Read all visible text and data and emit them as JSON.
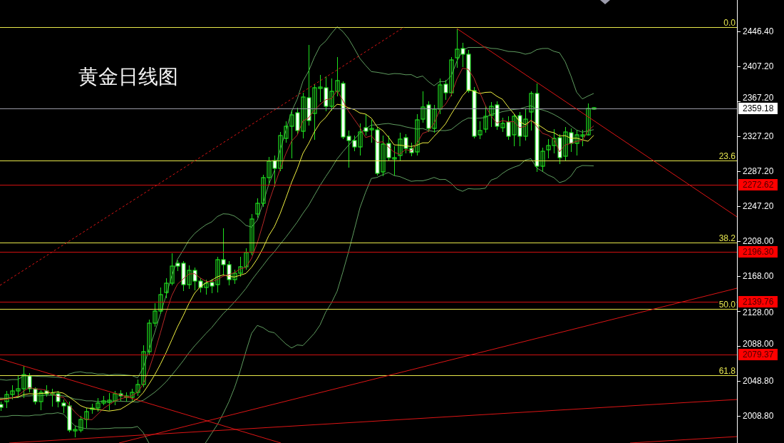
{
  "chart": {
    "title": "黄金日线图",
    "price_axis": [
      "2446.40",
      "2407.20",
      "2367.20",
      "2327.20",
      "2287.20",
      "2247.20",
      "2208.00",
      "2168.00",
      "2128.00",
      "2088.00",
      "2048.80",
      "2008.80"
    ],
    "price_markers": [
      {
        "kind": "bid",
        "label": "2359.18"
      },
      {
        "kind": "level",
        "label": "2272.62"
      },
      {
        "kind": "level",
        "label": "2196.30"
      },
      {
        "kind": "level",
        "label": "2139.76"
      },
      {
        "kind": "level",
        "label": "2079.37"
      }
    ],
    "fibonacci_levels": [
      "0.0",
      "23.6",
      "38.2",
      "50.0",
      "61.8"
    ]
  }
}
